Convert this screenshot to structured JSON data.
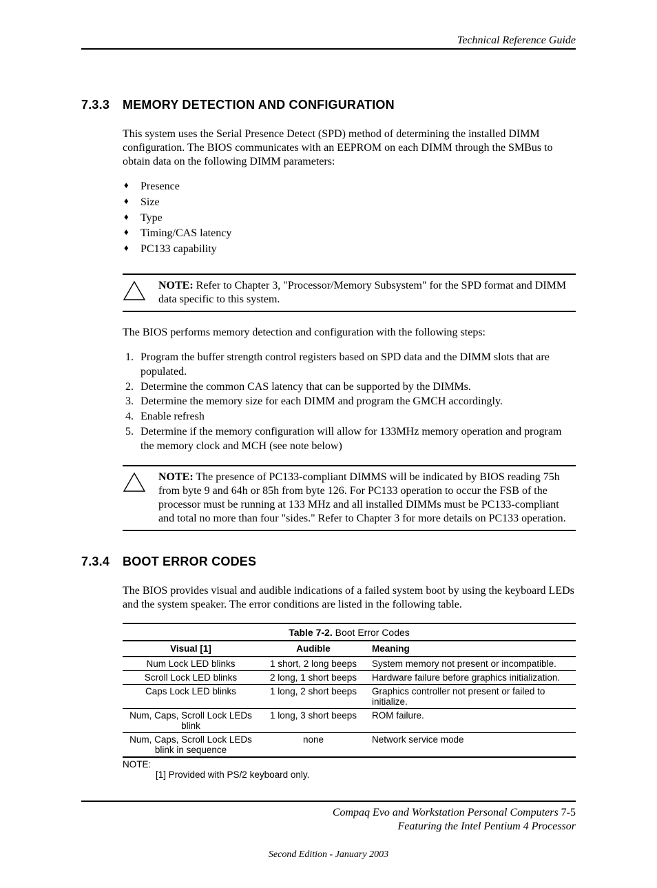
{
  "header": {
    "running": "Technical Reference Guide"
  },
  "sec733": {
    "num": "7.3.3",
    "title": "MEMORY DETECTION AND CONFIGURATION",
    "intro": "This system uses the Serial Presence Detect (SPD) method of determining the installed DIMM configuration. The BIOS communicates with an EEPROM on each DIMM through the SMBus to obtain data on the following DIMM parameters:",
    "bullets": [
      "Presence",
      "Size",
      "Type",
      "Timing/CAS latency",
      "PC133 capability"
    ],
    "note1_label": "NOTE:",
    "note1_body": " Refer to Chapter 3, \"Processor/Memory Subsystem\" for the SPD format and DIMM data specific to this system.",
    "mid": "The BIOS performs memory detection and configuration with the following steps:",
    "steps": [
      "Program the buffer strength control registers based on SPD data and the DIMM slots that are populated.",
      "Determine the common CAS latency that can be supported by the DIMMs.",
      "Determine the memory size for each DIMM and program the GMCH accordingly.",
      "Enable refresh",
      "Determine if the memory configuration will allow for 133MHz memory operation and program the memory clock and MCH  (see note below)"
    ],
    "note2_label": "NOTE:",
    "note2_body": " The presence of PC133-compliant DIMMS will be indicated by BIOS reading 75h from byte 9 and 64h or 85h from byte 126. For PC133 operation to occur the FSB of the processor must be running at 133 MHz and all installed DIMMs must be PC133-compliant and total no more than four \"sides.\" Refer to Chapter 3 for more details on PC133 operation."
  },
  "sec734": {
    "num": "7.3.4",
    "title": "BOOT ERROR CODES",
    "intro": "The BIOS provides visual and audible indications of a failed system boot by using the keyboard LEDs and the system speaker. The error conditions are listed in the following table.",
    "table": {
      "caption_strong": "Table 7-2.",
      "caption_rest": " Boot Error Codes",
      "headers": [
        "Visual [1]",
        "Audible",
        "Meaning"
      ],
      "rows": [
        [
          "Num Lock LED blinks",
          "1 short, 2 long beeps",
          "System memory not present or incompatible."
        ],
        [
          "Scroll Lock LED blinks",
          "2 long, 1 short beeps",
          "Hardware failure before graphics initialization."
        ],
        [
          "Caps Lock LED blinks",
          "1 long, 2 short beeps",
          "Graphics controller not present or failed to initialize."
        ],
        [
          "Num, Caps, Scroll Lock LEDs blink",
          "1 long, 3 short beeps",
          "ROM failure."
        ],
        [
          "Num, Caps, Scroll Lock LEDs blink in sequence",
          "none",
          "Network service mode"
        ]
      ],
      "note_label": "NOTE:",
      "footnote": "[1] Provided with PS/2 keyboard only."
    }
  },
  "footer": {
    "line1a": "Compaq Evo and Workstation Personal Computers",
    "line1b": "  7-5",
    "line2": "Featuring the Intel Pentium 4 Processor",
    "edition": "Second Edition - January 2003"
  }
}
